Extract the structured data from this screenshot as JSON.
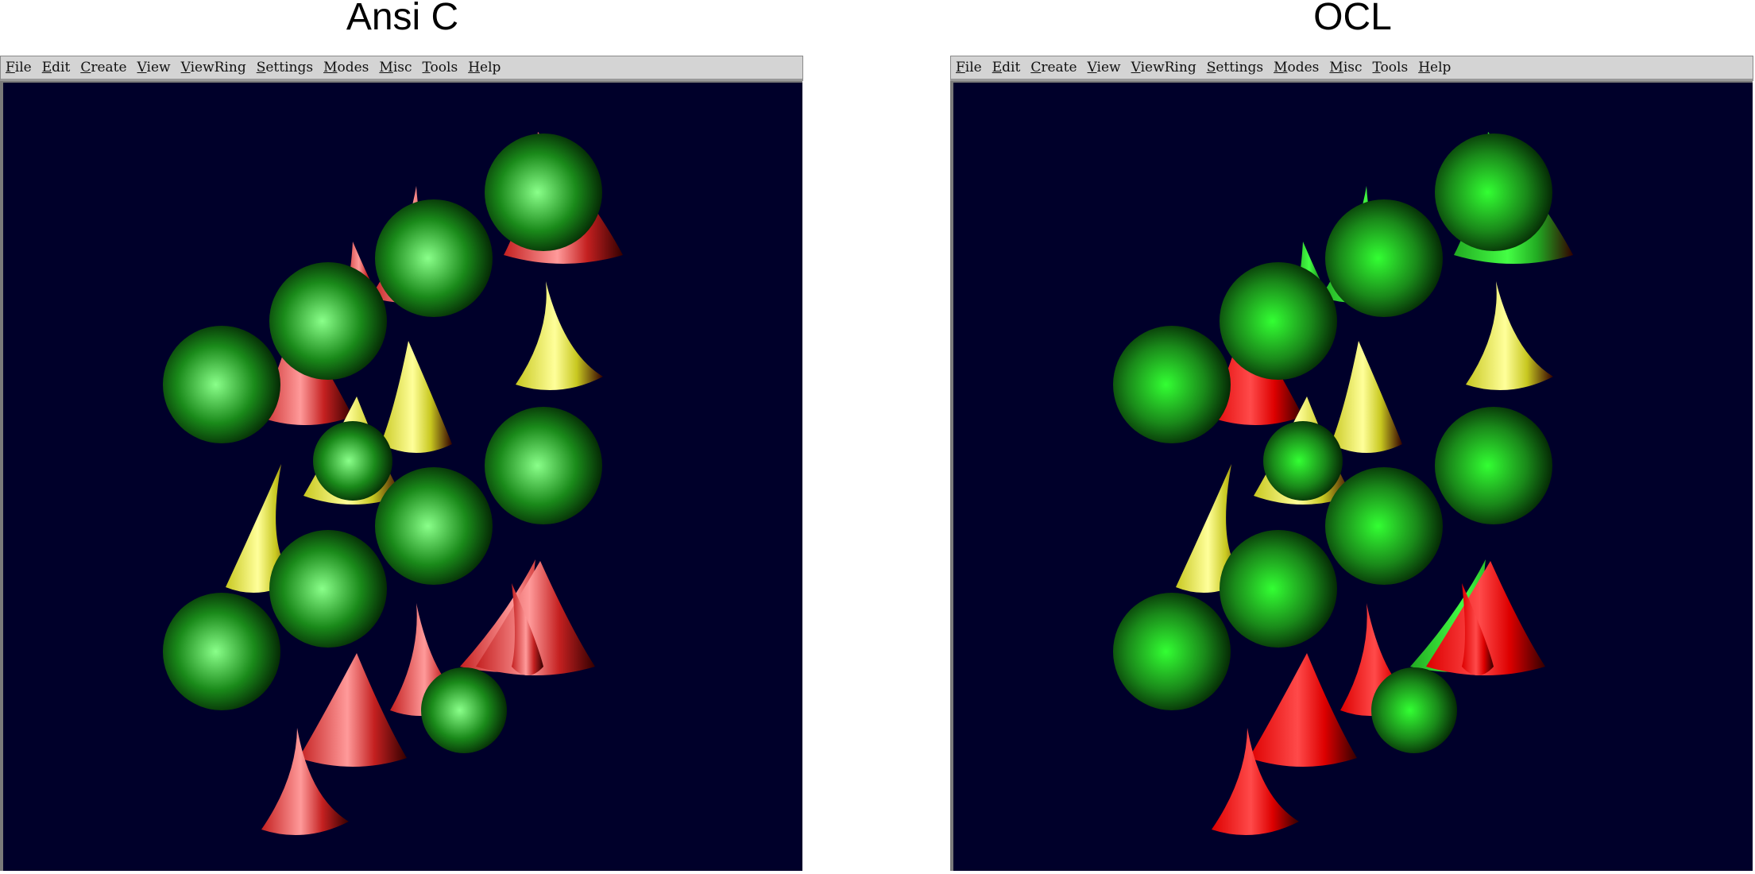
{
  "panels": [
    {
      "caption": "Ansi C",
      "menu": [
        "File",
        "Edit",
        "Create",
        "View",
        "ViewRing",
        "Settings",
        "Modes",
        "Misc",
        "Tools",
        "Help"
      ],
      "colors": {
        "background": "#00002a",
        "sphere": "#1a8a1a",
        "sphere_highlight": "#8aff8a",
        "cone_red": "#c42020",
        "cone_red_highlight": "#ff9a9a",
        "cone_yellow": "#c8c820",
        "cone_yellow_highlight": "#ffff9a",
        "cone_upper_right": "#c42020",
        "cone_upper_right_highlight": "#ff9a9a"
      }
    },
    {
      "caption": "OCL",
      "menu": [
        "File",
        "Edit",
        "Create",
        "View",
        "ViewRing",
        "Settings",
        "Modes",
        "Misc",
        "Tools",
        "Help"
      ],
      "colors": {
        "background": "#00002a",
        "sphere": "#1a8a1a",
        "sphere_highlight": "#33ff33",
        "cone_red": "#dd0000",
        "cone_red_highlight": "#ff4a4a",
        "cone_yellow": "#c8c820",
        "cone_yellow_highlight": "#ffff9a",
        "cone_upper_right": "#22aa22",
        "cone_upper_right_highlight": "#44ff44"
      }
    }
  ],
  "scene": {
    "spheres": [
      "sphere",
      "sphere",
      "sphere",
      "sphere",
      "sphere",
      "sphere",
      "sphere",
      "sphere",
      "sphere",
      "sphere"
    ],
    "cones": [
      "red",
      "red",
      "red",
      "yellow",
      "yellow",
      "yellow",
      "yellow",
      "upper_right",
      "upper_right",
      "upper_right",
      "red",
      "red",
      "red",
      "red"
    ]
  }
}
